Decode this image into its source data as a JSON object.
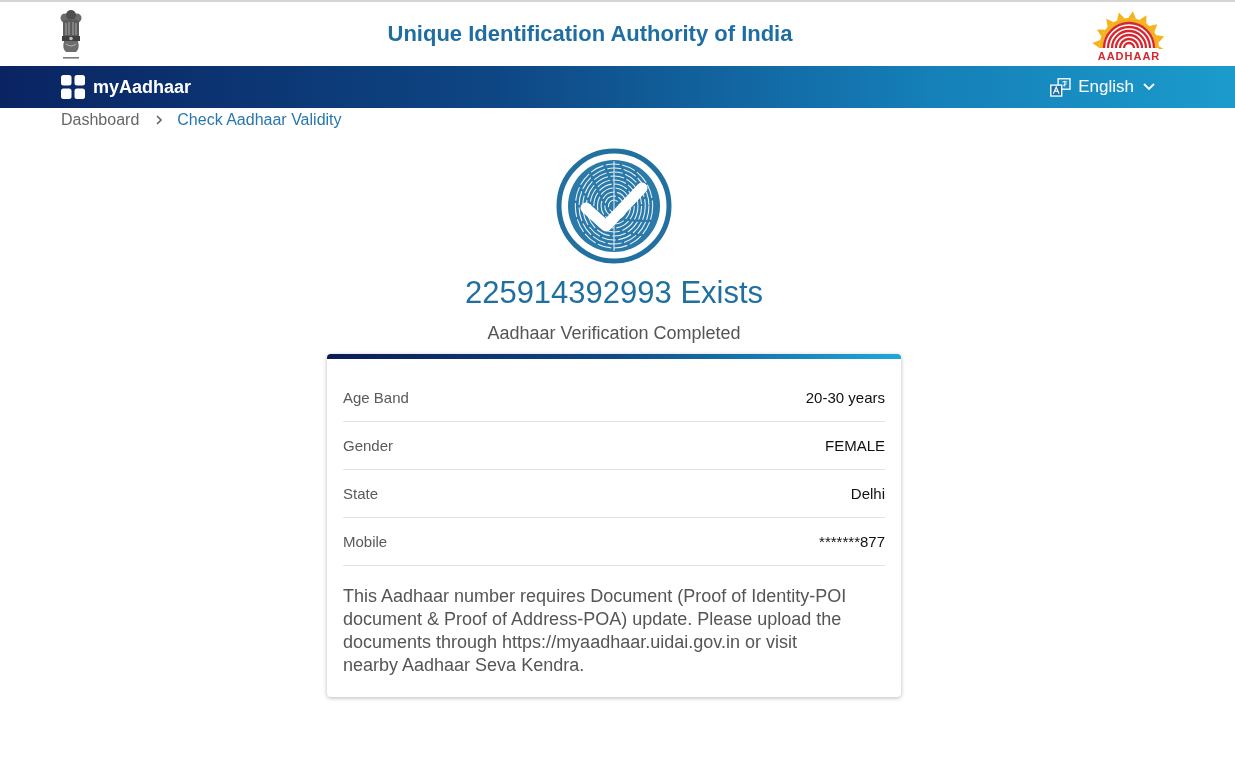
{
  "header": {
    "title": "Unique Identification Authority of India",
    "logo_text": "AADHAAR"
  },
  "navbar": {
    "app_name": "myAadhaar",
    "language": "English"
  },
  "breadcrumb": [
    {
      "label": "Dashboard",
      "current": false
    },
    {
      "label": "Check Aadhaar Validity",
      "current": true
    }
  ],
  "result": {
    "heading": "225914392993 Exists",
    "subheading": "Aadhaar Verification Completed"
  },
  "details": [
    {
      "label": "Age Band",
      "value": "20-30 years"
    },
    {
      "label": "Gender",
      "value": "FEMALE"
    },
    {
      "label": "State",
      "value": "Delhi"
    },
    {
      "label": "Mobile",
      "value": "*******877"
    }
  ],
  "note": "This Aadhaar number requires Document (Proof of Identity-POI document & Proof of Address-POA) update. Please upload the documents through https://myaadhaar.uidai.gov.in or visit nearby Aadhaar Seva Kendra."
}
